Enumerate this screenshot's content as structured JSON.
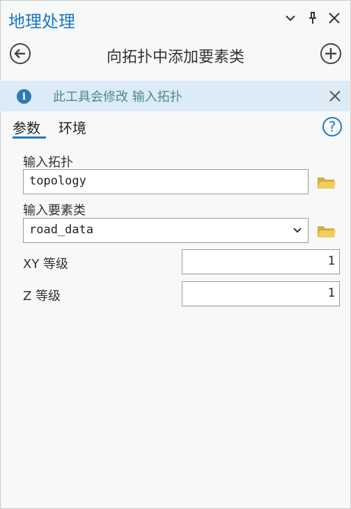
{
  "window": {
    "title": "地理处理",
    "collapse_icon": "chevron-down-icon",
    "pin_icon": "pin-icon",
    "close_icon": "close-icon"
  },
  "tool": {
    "title": "向拓扑中添加要素类",
    "back_icon": "back-arrow-icon",
    "add_icon": "add-circle-icon"
  },
  "info": {
    "icon": "info-icon",
    "text": "此工具会修改 输入拓扑",
    "close_icon": "close-icon"
  },
  "tabs": [
    {
      "label": "参数",
      "active": true
    },
    {
      "label": "环境",
      "active": false
    }
  ],
  "help_label": "?",
  "params": {
    "input_topology": {
      "label": "输入拓扑",
      "value": "topology"
    },
    "input_feature_class": {
      "label": "输入要素类",
      "value": "road_data"
    },
    "xy_rank": {
      "label": "XY 等级",
      "value": "1"
    },
    "z_rank": {
      "label": "Z 等级",
      "value": "1"
    }
  },
  "colors": {
    "accent": "#1a7ac4",
    "info_bg": "#dcebf5",
    "info_text": "#4b8a8a",
    "folder": "#e8c45a"
  }
}
